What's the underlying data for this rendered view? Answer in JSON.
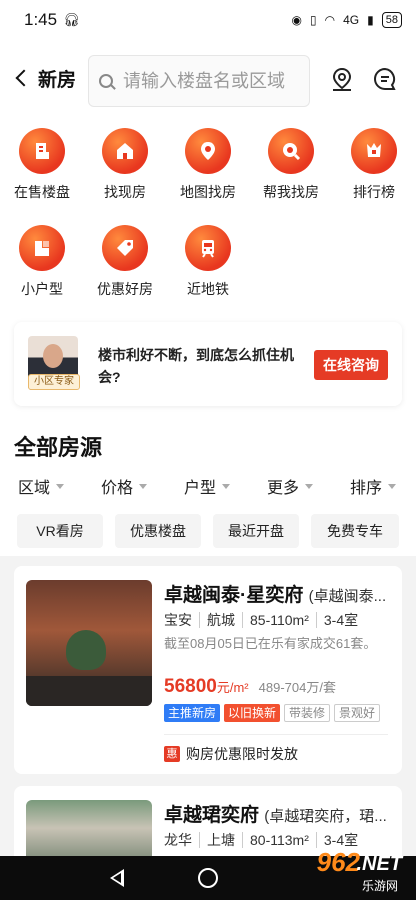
{
  "status_bar": {
    "time": "1:45",
    "signal_label": "4G",
    "battery": "58"
  },
  "header": {
    "back_label": "新房",
    "search_placeholder": "请输入楼盘名或区域"
  },
  "categories": [
    {
      "label": "在售楼盘",
      "icon": "building-icon"
    },
    {
      "label": "找现房",
      "icon": "house-icon"
    },
    {
      "label": "地图找房",
      "icon": "map-pin-icon"
    },
    {
      "label": "帮我找房",
      "icon": "magnifier-icon"
    },
    {
      "label": "排行榜",
      "icon": "ranking-icon"
    },
    {
      "label": "小户型",
      "icon": "small-unit-icon"
    },
    {
      "label": "优惠好房",
      "icon": "discount-tag-icon"
    },
    {
      "label": "近地铁",
      "icon": "metro-icon"
    }
  ],
  "ad": {
    "badge": "小区专家",
    "text": "楼市利好不断，到底怎么抓住机会?",
    "button": "在线咨询"
  },
  "section_title": "全部房源",
  "filters": [
    "区域",
    "价格",
    "户型",
    "更多",
    "排序"
  ],
  "quick_tags": [
    "VR看房",
    "优惠楼盘",
    "最近开盘",
    "免费专车"
  ],
  "listings": [
    {
      "name": "卓越闽泰·星奕府",
      "alias": "(卓越闽泰...",
      "district": "宝安",
      "area": "航城",
      "size": "85-110m²",
      "rooms": "3-4室",
      "desc": "截至08月05日已在乐有家成交61套。",
      "price": "56800",
      "price_unit": "元/m²",
      "total": "489-704万/套",
      "badges": [
        "主推新房",
        "以旧换新",
        "带装修",
        "景观好"
      ],
      "promo": "购房优惠限时发放",
      "promo_icon": "惠"
    },
    {
      "name": "卓越珺奕府",
      "alias": "(卓越珺奕府，珺...",
      "district": "龙华",
      "area": "上塘",
      "size": "80-113m²",
      "rooms": "3-4室"
    }
  ],
  "watermark": {
    "num": "962",
    "net": ".NET",
    "sub": "乐游网"
  }
}
